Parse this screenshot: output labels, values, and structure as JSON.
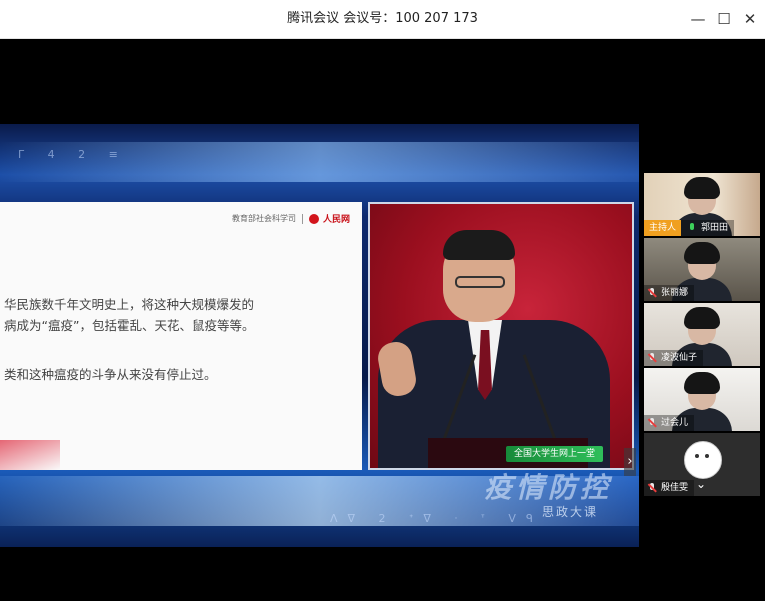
{
  "window": {
    "title": "腾讯会议 会议号：100 207 173",
    "minimize": "—",
    "maximize": "☐",
    "close": "✕"
  },
  "stage": {
    "glyphs_top": "ᒥ 4 2 ≡",
    "glyphs_bottom": "ᐱᐁ 2  ᐩᐁ  ᐧ  ᐪ   ᐯᑫ",
    "slide": {
      "header_org": "教育部社会科学司",
      "header_brand": "人民网",
      "lines": [
        "华民族数千年文明史上，将这种大规模爆发的",
        "病成为“瘟疫”，包括霍乱、天花、鼠疫等等。",
        "类和这种瘟疫的斗争从来没有停止过。"
      ]
    },
    "speaker": {
      "banner": "全国大学生网上一堂"
    },
    "show_logo": "疫情防控",
    "show_subtitle": "思政大课",
    "next_arrow": "›"
  },
  "participants": [
    {
      "name": "郭田田",
      "host": true,
      "host_label": "主持人",
      "mic": "active"
    },
    {
      "name": "张丽娜",
      "host": false,
      "mic": "muted"
    },
    {
      "name": "凌波仙子",
      "host": false,
      "mic": "muted"
    },
    {
      "name": "过会儿",
      "host": false,
      "mic": "muted"
    },
    {
      "name": "殷佳雯",
      "host": false,
      "mic": "muted"
    }
  ],
  "expand_icon": "⌄"
}
